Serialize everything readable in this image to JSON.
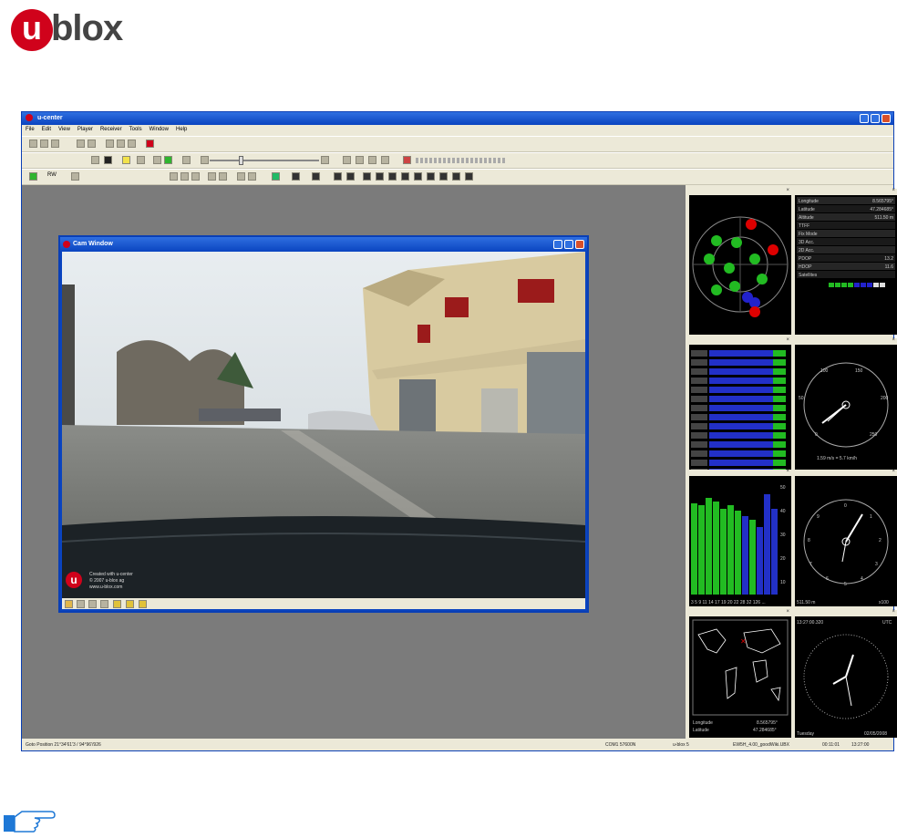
{
  "logo": {
    "mark": "u",
    "word": "blox"
  },
  "app": {
    "title": "u-center",
    "menu": [
      "File",
      "Edit",
      "View",
      "Player",
      "Receiver",
      "Tools",
      "Window",
      "Help"
    ],
    "toolbar_texts": {
      "rate": "RW"
    }
  },
  "cam": {
    "title": "Cam Window",
    "credit": [
      "Created with u-center",
      "© 2007 u-blox ag",
      "www.u-blox.com"
    ]
  },
  "panes": {
    "data": {
      "rows": [
        {
          "label": "Longitude",
          "value": "8.565795°"
        },
        {
          "label": "Latitude",
          "value": "47.284685°"
        },
        {
          "label": "Altitude",
          "value": "511.50 m"
        },
        {
          "label": "TTFF",
          "value": ""
        },
        {
          "label": "Fix Mode",
          "value": ""
        },
        {
          "label": "3D Acc.",
          "value": ""
        },
        {
          "label": "2D Acc.",
          "value": ""
        },
        {
          "label": "PDOP",
          "value": "13.2"
        },
        {
          "label": "HDOP",
          "value": "11.6"
        },
        {
          "label": "Satellites",
          "value": ""
        }
      ]
    },
    "speed": {
      "ticks": [
        "0",
        "50",
        "100",
        "150",
        "200",
        "250"
      ],
      "readout": "1.59 m/s = 5.7 km/h"
    },
    "altimeter": {
      "ticks": [
        "0",
        "1",
        "2",
        "3",
        "4",
        "5",
        "6",
        "7",
        "8",
        "9"
      ],
      "left": "511.50 m",
      "right": "x100"
    },
    "level_axis": [
      "50",
      "40",
      "30",
      "20",
      "10"
    ],
    "level_labels": "3 5 9 11 14 17 19 20 22 28 32 126 ...",
    "map": {
      "rows": [
        {
          "label": "Longitude",
          "value": "8.565795°"
        },
        {
          "label": "Latitude",
          "value": "47.284685°"
        }
      ]
    },
    "clock": {
      "time": "13:27:00.320",
      "zone": "UTC",
      "day": "Tuesday",
      "date": "02/05/2008"
    }
  },
  "statusbar": {
    "goto": "Goto Position 21°34'61'3 / 94°96'/926",
    "port": "COM1 57600N",
    "receiver": "u-blox 5",
    "file": "EW5H_4.00_goodWiki.UBX",
    "elapsed": "00:11:01",
    "clock": "13:27:00"
  }
}
